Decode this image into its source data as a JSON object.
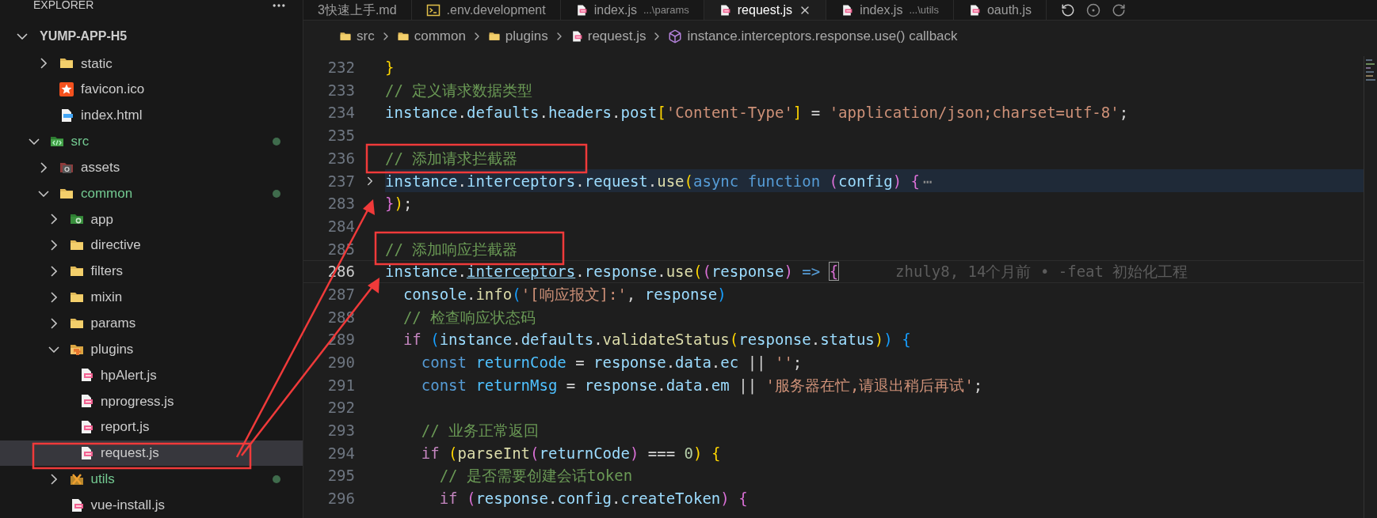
{
  "tabs": [
    {
      "label": "3快速上手.md",
      "kind": "md",
      "selected": false
    },
    {
      "label": ".env.development",
      "kind": "env",
      "selected": false
    },
    {
      "label": "index.js",
      "description": "...\\params",
      "kind": "js",
      "selected": false
    },
    {
      "label": "request.js",
      "kind": "js",
      "selected": true
    },
    {
      "label": "index.js",
      "description": "...\\utils",
      "kind": "js",
      "selected": false
    },
    {
      "label": "oauth.js",
      "kind": "js",
      "selected": false
    }
  ],
  "explorer": {
    "title": "EXPLORER",
    "root": {
      "label": "YUMP-APP-H5",
      "expanded": true
    },
    "upper_items": [
      {
        "label": "static",
        "kind": "folder",
        "expanded": false,
        "selected": false,
        "modified": false
      },
      {
        "label": "favicon.ico",
        "kind": "file-favicon",
        "selected": false,
        "modified": false
      },
      {
        "label": "index.html",
        "kind": "file-html",
        "selected": false,
        "modified": false
      }
    ],
    "items": [
      {
        "label": "src",
        "kind": "folder-src",
        "expanded": true,
        "selected": false,
        "modified": true,
        "children": [
          {
            "label": "assets",
            "kind": "folder-assets",
            "expanded": false,
            "selected": false,
            "modified": false
          },
          {
            "label": "common",
            "kind": "folder",
            "expanded": true,
            "selected": false,
            "modified": true,
            "children": [
              {
                "label": "app",
                "kind": "folder-app",
                "expanded": false,
                "selected": false,
                "modified": false
              },
              {
                "label": "directive",
                "kind": "folder",
                "expanded": false,
                "selected": false,
                "modified": false
              },
              {
                "label": "filters",
                "kind": "folder",
                "expanded": false,
                "selected": false,
                "modified": false
              },
              {
                "label": "mixin",
                "kind": "folder",
                "expanded": false,
                "selected": false,
                "modified": false
              },
              {
                "label": "params",
                "kind": "folder",
                "expanded": false,
                "selected": false,
                "modified": false
              },
              {
                "label": "plugins",
                "kind": "folder-plugins",
                "expanded": true,
                "selected": false,
                "modified": false,
                "children": [
                  {
                    "label": "hpAlert.js",
                    "kind": "file-js",
                    "selected": false,
                    "modified": false
                  },
                  {
                    "label": "nprogress.js",
                    "kind": "file-js",
                    "selected": false,
                    "modified": false
                  },
                  {
                    "label": "report.js",
                    "kind": "file-js",
                    "selected": false,
                    "modified": false
                  },
                  {
                    "label": "request.js",
                    "kind": "file-js",
                    "selected": true,
                    "modified": false
                  }
                ]
              },
              {
                "label": "utils",
                "kind": "folder-utils",
                "expanded": false,
                "selected": false,
                "modified": true
              },
              {
                "label": "vue-install.js",
                "kind": "file-js",
                "selected": false,
                "modified": false
              }
            ]
          }
        ]
      }
    ]
  },
  "breadcrumb": [
    {
      "label": "src",
      "kind": "folder"
    },
    {
      "label": "common",
      "kind": "folder"
    },
    {
      "label": "plugins",
      "kind": "folder"
    },
    {
      "label": "request.js",
      "kind": "file-js"
    },
    {
      "label": "instance.interceptors.response.use() callback",
      "kind": "symbol"
    }
  ],
  "code": [
    {
      "number": "232",
      "active": false,
      "tokens": [
        {
          "kind": "bracket1",
          "text": "}"
        }
      ]
    },
    {
      "number": "233",
      "active": false,
      "tokens": [
        {
          "kind": "comment",
          "text": "// 定义请求数据类型"
        }
      ]
    },
    {
      "number": "234",
      "active": false,
      "tokens": [
        {
          "kind": "var",
          "text": "instance"
        },
        {
          "kind": "plain",
          "text": "."
        },
        {
          "kind": "var",
          "text": "defaults"
        },
        {
          "kind": "plain",
          "text": "."
        },
        {
          "kind": "var",
          "text": "headers"
        },
        {
          "kind": "plain",
          "text": "."
        },
        {
          "kind": "var",
          "text": "post"
        },
        {
          "kind": "bracket1",
          "text": "["
        },
        {
          "kind": "str",
          "text": "'Content-Type'"
        },
        {
          "kind": "bracket1",
          "text": "]"
        },
        {
          "kind": "plain",
          "text": " = "
        },
        {
          "kind": "str",
          "text": "'application/json;charset=utf-8'"
        },
        {
          "kind": "plain",
          "text": ";"
        }
      ]
    },
    {
      "number": "235",
      "active": false
    },
    {
      "number": "236",
      "active": false,
      "tokens": [
        {
          "kind": "comment",
          "text": "// 添加请求拦截器"
        }
      ]
    },
    {
      "number": "237",
      "active": false,
      "folded": true,
      "tokens": [
        {
          "kind": "var",
          "text": "instance"
        },
        {
          "kind": "plain",
          "text": "."
        },
        {
          "kind": "var",
          "text": "interceptors"
        },
        {
          "kind": "plain",
          "text": "."
        },
        {
          "kind": "var",
          "text": "request"
        },
        {
          "kind": "plain",
          "text": "."
        },
        {
          "kind": "func",
          "text": "use"
        },
        {
          "kind": "bracket1",
          "text": "("
        },
        {
          "kind": "keyword",
          "text": "async function "
        },
        {
          "kind": "bracket2",
          "text": "("
        },
        {
          "kind": "var",
          "text": "config"
        },
        {
          "kind": "bracket2",
          "text": ") {"
        },
        {
          "kind": "fold",
          "text": "⋯"
        }
      ]
    },
    {
      "number": "283",
      "active": false,
      "tokens": [
        {
          "kind": "bracket2",
          "text": "}"
        },
        {
          "kind": "bracket1",
          "text": ")"
        },
        {
          "kind": "plain",
          "text": ";"
        }
      ]
    },
    {
      "number": "284",
      "active": false
    },
    {
      "number": "285",
      "active": false,
      "tokens": [
        {
          "kind": "comment",
          "text": "// 添加响应拦截器"
        }
      ]
    },
    {
      "number": "286",
      "active": true,
      "blame": "zhuly8, 14个月前 • -feat 初始化工程",
      "tokens": [
        {
          "kind": "var",
          "text": "instance"
        },
        {
          "kind": "plain",
          "text": "."
        },
        {
          "kind": "link",
          "text": "interceptors"
        },
        {
          "kind": "plain",
          "text": "."
        },
        {
          "kind": "var",
          "text": "response"
        },
        {
          "kind": "plain",
          "text": "."
        },
        {
          "kind": "func",
          "text": "use"
        },
        {
          "kind": "bracket1",
          "text": "("
        },
        {
          "kind": "bracket2",
          "text": "("
        },
        {
          "kind": "var",
          "text": "response"
        },
        {
          "kind": "bracket2",
          "text": ")"
        },
        {
          "kind": "keyword",
          "text": " => "
        },
        {
          "kind": "matched",
          "text": "{"
        }
      ]
    },
    {
      "number": "287",
      "active": false,
      "tokens": [
        {
          "kind": "var",
          "text": "  console"
        },
        {
          "kind": "plain",
          "text": "."
        },
        {
          "kind": "func",
          "text": "info"
        },
        {
          "kind": "bracket3",
          "text": "("
        },
        {
          "kind": "str",
          "text": "'[响应报文]:'"
        },
        {
          "kind": "plain",
          "text": ", "
        },
        {
          "kind": "var",
          "text": "response"
        },
        {
          "kind": "bracket3",
          "text": ")"
        }
      ]
    },
    {
      "number": "288",
      "active": false,
      "tokens": [
        {
          "kind": "comment",
          "text": "  // 检查响应状态码"
        }
      ]
    },
    {
      "number": "289",
      "active": false,
      "tokens": [
        {
          "kind": "control",
          "text": "  if "
        },
        {
          "kind": "bracket3",
          "text": "("
        },
        {
          "kind": "var",
          "text": "instance"
        },
        {
          "kind": "plain",
          "text": "."
        },
        {
          "kind": "var",
          "text": "defaults"
        },
        {
          "kind": "plain",
          "text": "."
        },
        {
          "kind": "func",
          "text": "validateStatus"
        },
        {
          "kind": "bracket1",
          "text": "("
        },
        {
          "kind": "var",
          "text": "response"
        },
        {
          "kind": "plain",
          "text": "."
        },
        {
          "kind": "var",
          "text": "status"
        },
        {
          "kind": "bracket1",
          "text": ")"
        },
        {
          "kind": "bracket3",
          "text": ") {"
        }
      ]
    },
    {
      "number": "290",
      "active": false,
      "tokens": [
        {
          "kind": "keyword",
          "text": "    const "
        },
        {
          "kind": "const",
          "text": "returnCode"
        },
        {
          "kind": "plain",
          "text": " = "
        },
        {
          "kind": "var",
          "text": "response"
        },
        {
          "kind": "plain",
          "text": "."
        },
        {
          "kind": "var",
          "text": "data"
        },
        {
          "kind": "plain",
          "text": "."
        },
        {
          "kind": "var",
          "text": "ec"
        },
        {
          "kind": "plain",
          "text": " || "
        },
        {
          "kind": "str",
          "text": "''"
        },
        {
          "kind": "plain",
          "text": ";"
        }
      ]
    },
    {
      "number": "291",
      "active": false,
      "tokens": [
        {
          "kind": "keyword",
          "text": "    const "
        },
        {
          "kind": "const",
          "text": "returnMsg"
        },
        {
          "kind": "plain",
          "text": " = "
        },
        {
          "kind": "var",
          "text": "response"
        },
        {
          "kind": "plain",
          "text": "."
        },
        {
          "kind": "var",
          "text": "data"
        },
        {
          "kind": "plain",
          "text": "."
        },
        {
          "kind": "var",
          "text": "em"
        },
        {
          "kind": "plain",
          "text": " || "
        },
        {
          "kind": "str",
          "text": "'服务器在忙,请退出稍后再试'"
        },
        {
          "kind": "plain",
          "text": ";"
        }
      ]
    },
    {
      "number": "292",
      "active": false
    },
    {
      "number": "293",
      "active": false,
      "tokens": [
        {
          "kind": "comment",
          "text": "    // 业务正常返回"
        }
      ]
    },
    {
      "number": "294",
      "active": false,
      "tokens": [
        {
          "kind": "control",
          "text": "    if "
        },
        {
          "kind": "bracket1",
          "text": "("
        },
        {
          "kind": "func",
          "text": "parseInt"
        },
        {
          "kind": "bracket2",
          "text": "("
        },
        {
          "kind": "var",
          "text": "returnCode"
        },
        {
          "kind": "bracket2",
          "text": ")"
        },
        {
          "kind": "plain",
          "text": " === "
        },
        {
          "kind": "number",
          "text": "0"
        },
        {
          "kind": "bracket1",
          "text": ") {"
        }
      ]
    },
    {
      "number": "295",
      "active": false,
      "tokens": [
        {
          "kind": "comment",
          "text": "      // 是否需要创建会话token"
        }
      ]
    },
    {
      "number": "296",
      "active": false,
      "tokens": [
        {
          "kind": "control",
          "text": "      if "
        },
        {
          "kind": "bracket2",
          "text": "("
        },
        {
          "kind": "var",
          "text": "response"
        },
        {
          "kind": "plain",
          "text": "."
        },
        {
          "kind": "var",
          "text": "config"
        },
        {
          "kind": "plain",
          "text": "."
        },
        {
          "kind": "var",
          "text": "createToken"
        },
        {
          "kind": "bracket2",
          "text": ") {"
        }
      ]
    }
  ]
}
